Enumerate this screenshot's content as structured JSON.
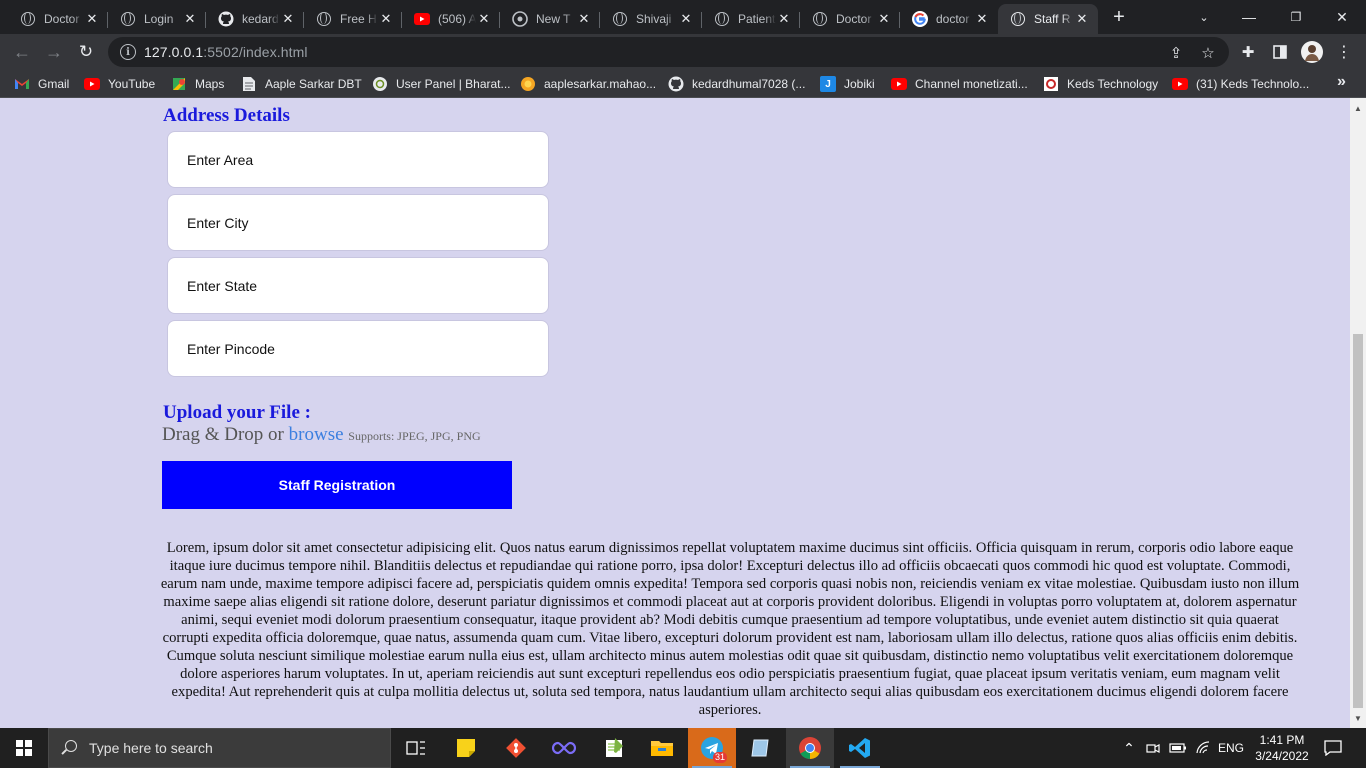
{
  "browser": {
    "tabs": [
      {
        "title": "Doctor",
        "icon": "globe-icon"
      },
      {
        "title": "Login",
        "icon": "globe-icon"
      },
      {
        "title": "kedard",
        "icon": "github-icon"
      },
      {
        "title": "Free H",
        "icon": "globe-icon"
      },
      {
        "title": "(506) A",
        "icon": "youtube-icon"
      },
      {
        "title": "New T",
        "icon": "tab-icon"
      },
      {
        "title": "Shivaji",
        "icon": "globe-icon"
      },
      {
        "title": "Patient",
        "icon": "globe-icon"
      },
      {
        "title": "Doctor",
        "icon": "globe-icon"
      },
      {
        "title": "doctor",
        "icon": "google-icon"
      },
      {
        "title": "Staff R",
        "icon": "globe-icon",
        "active": true
      }
    ],
    "url_host": "127.0.0.1",
    "url_rest": ":5502/index.html",
    "bookmarks": [
      {
        "label": "Gmail",
        "icon": "gmail-icon"
      },
      {
        "label": "YouTube",
        "icon": "youtube-icon"
      },
      {
        "label": "Maps",
        "icon": "maps-icon"
      },
      {
        "label": "Aaple Sarkar DBT",
        "icon": "document-icon"
      },
      {
        "label": "User Panel | Bharat...",
        "icon": "emblem-icon"
      },
      {
        "label": "aaplesarkar.mahao...",
        "icon": "sun-icon"
      },
      {
        "label": "kedardhumal7028 (...",
        "icon": "github-icon"
      },
      {
        "label": "Jobiki",
        "icon": "jobiki-icon"
      },
      {
        "label": "Channel monetizati...",
        "icon": "youtube-icon"
      },
      {
        "label": "Keds Technology",
        "icon": "keds-icon"
      },
      {
        "label": "(31) Keds Technolo...",
        "icon": "youtube-icon"
      }
    ],
    "overflow": "»"
  },
  "form": {
    "address_heading": "Address Details",
    "area_placeholder": "Enter Area",
    "city_placeholder": "Enter City",
    "state_placeholder": "Enter State",
    "pincode_placeholder": "Enter Pincode",
    "upload_heading": "Upload your File :",
    "drag_text": "Drag & Drop or",
    "browse_link": "browse",
    "supports_text": "Supports: JPEG, JPG, PNG",
    "submit_label": "Staff Registration"
  },
  "lorem": "Lorem, ipsum dolor sit amet consectetur adipisicing elit. Quos natus earum dignissimos repellat voluptatem maxime ducimus sint officiis. Officia quisquam in rerum, corporis odio labore eaque itaque iure ducimus tempore nihil. Blanditiis delectus et repudiandae qui ratione porro, ipsa dolor! Excepturi delectus illo ad officiis obcaecati quos commodi hic quod est voluptate. Commodi, earum nam unde, maxime tempore adipisci facere ad, perspiciatis quidem omnis expedita! Tempora sed corporis quasi nobis non, reiciendis veniam ex vitae molestiae. Quibusdam iusto non illum maxime saepe alias eligendi sit ratione dolore, deserunt pariatur dignissimos et commodi placeat aut at corporis provident doloribus. Eligendi in voluptas porro voluptatem at, dolorem aspernatur animi, sequi eveniet modi dolorum praesentium consequatur, itaque provident ab? Modi debitis cumque praesentium ad tempore voluptatibus, unde eveniet autem distinctio sit quia quaerat corrupti expedita officia doloremque, quae natus, assumenda quam cum. Vitae libero, excepturi dolorum provident est nam, laboriosam ullam illo delectus, ratione quos alias officiis enim debitis. Cumque soluta nesciunt similique molestiae earum nulla eius est, ullam architecto minus autem molestias odit quae sit quibusdam, distinctio nemo voluptatibus velit exercitationem doloremque dolore asperiores harum voluptates. In ut, aperiam reiciendis aut sunt excepturi repellendus eos odio perspiciatis praesentium fugiat, quae placeat ipsum veritatis veniam, eum magnam velit expedita! Aut reprehenderit quis at culpa mollitia delectus ut, soluta sed tempora, natus laudantium ullam architecto sequi alias quibusdam eos exercitationem ducimus eligendi dolorem facere asperiores.",
  "taskbar": {
    "search_placeholder": "Type here to search",
    "telegram_badge": "31",
    "language": "ENG",
    "time": "1:41 PM",
    "date": "3/24/2022"
  },
  "colors": {
    "page_bg": "#d6d4ee",
    "heading": "#1a1adc",
    "submit_bg": "#0000ff",
    "browse_link": "#3b7fe0"
  }
}
